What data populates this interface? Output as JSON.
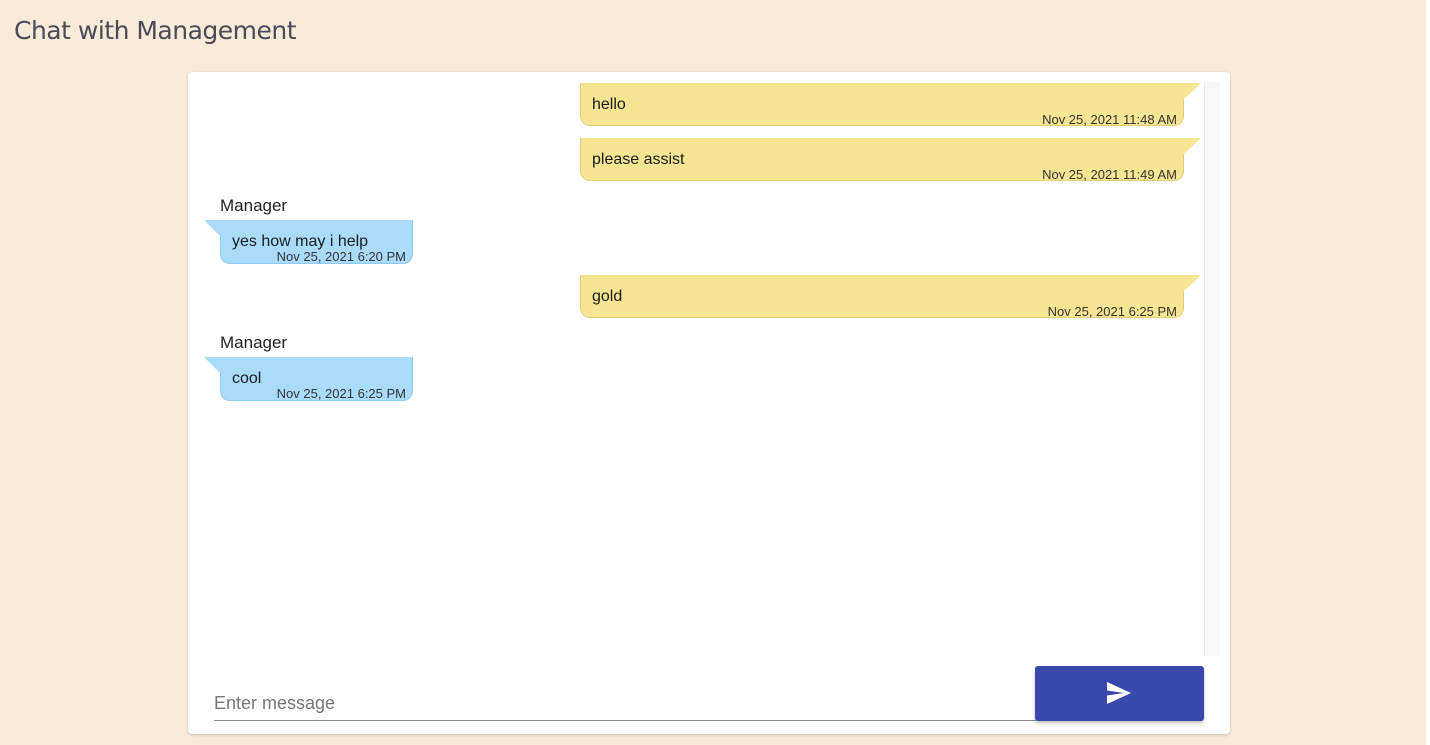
{
  "header": {
    "title": "Chat with Management"
  },
  "messages": [
    {
      "direction": "outgoing",
      "text": "hello",
      "time": "Nov 25, 2021 11:48 AM"
    },
    {
      "direction": "outgoing",
      "text": "please assist",
      "time": "Nov 25, 2021 11:49 AM"
    },
    {
      "direction": "incoming",
      "sender": "Manager",
      "text": "yes how may i help",
      "time": "Nov 25, 2021 6:20 PM"
    },
    {
      "direction": "outgoing",
      "text": "gold",
      "time": "Nov 25, 2021 6:25 PM"
    },
    {
      "direction": "incoming",
      "sender": "Manager",
      "text": "cool",
      "time": "Nov 25, 2021 6:25 PM"
    }
  ],
  "composer": {
    "placeholder": "Enter message",
    "value": "",
    "send_icon": "send-icon"
  },
  "colors": {
    "page_background": "#faead8",
    "outgoing_bubble": "#f7e594",
    "incoming_bubble": "#a9dbfb",
    "send_button": "#3949ab"
  }
}
